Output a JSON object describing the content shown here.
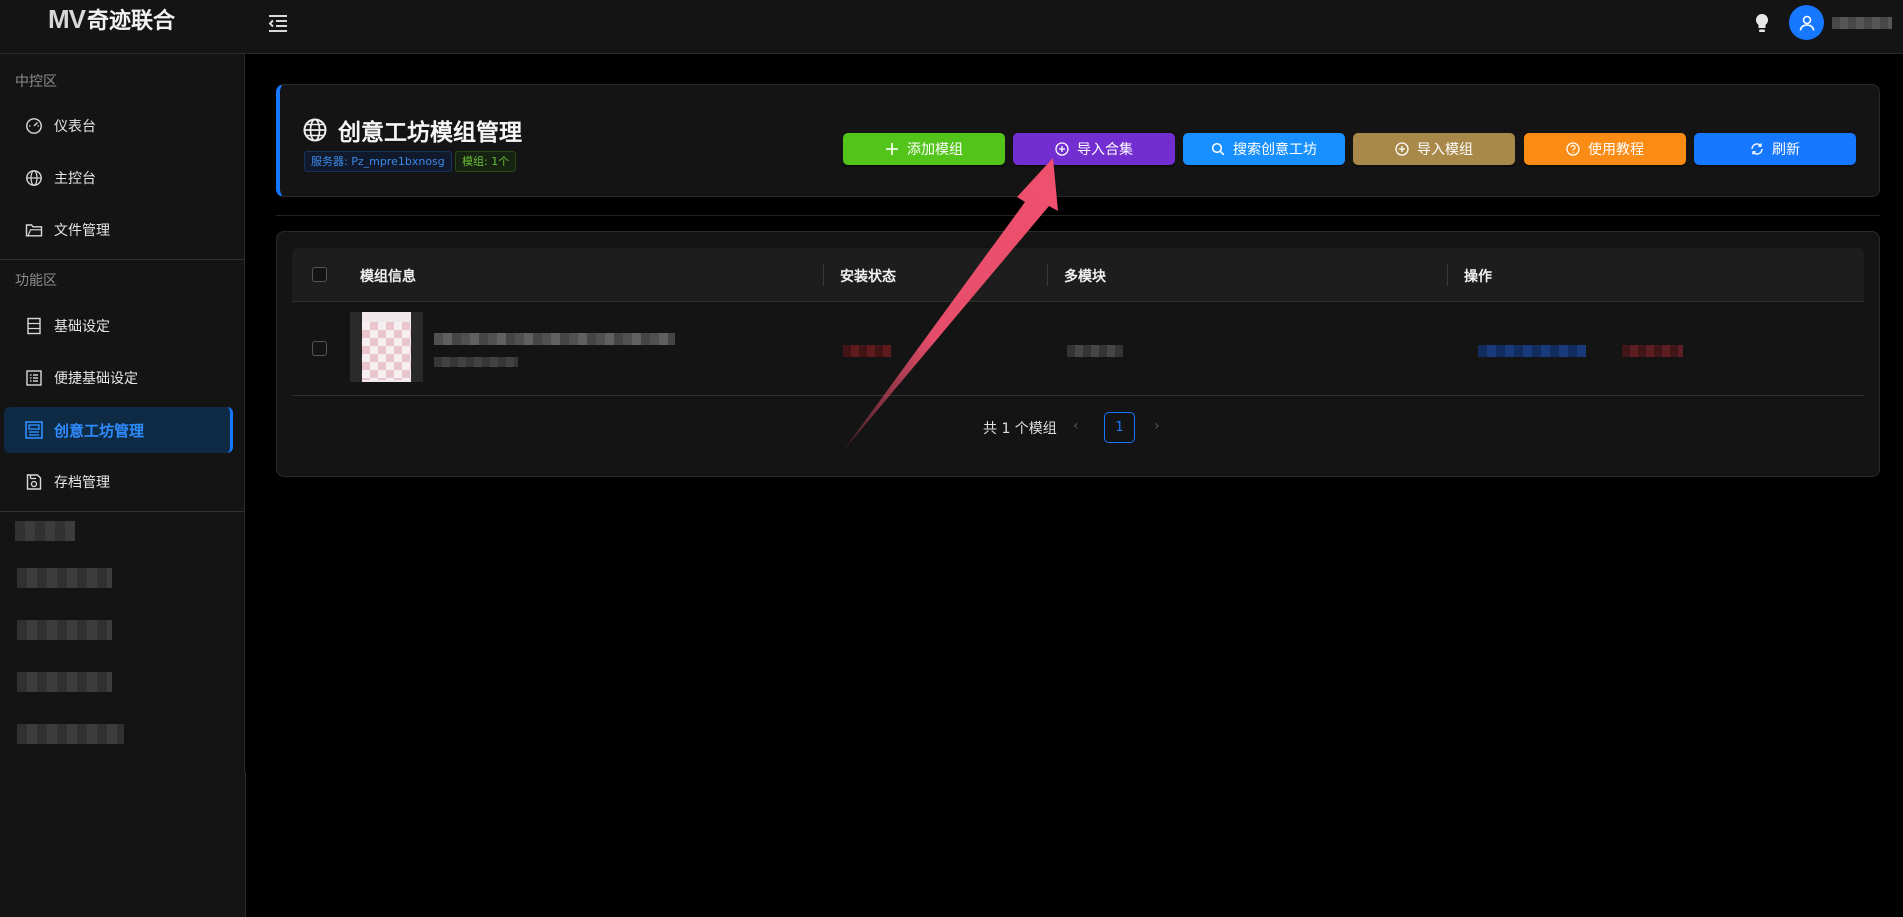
{
  "topbar": {
    "logo_mark": "MV",
    "logo_text": "奇迹联合",
    "menu_icon": "menu-fold-icon",
    "bulb_icon": "bulb-icon",
    "avatar_icon": "user-icon"
  },
  "sidebar": {
    "section_control": "中控区",
    "items_control": [
      {
        "label": "仪表台",
        "icon": "dashboard-icon"
      },
      {
        "label": "主控台",
        "icon": "globe-icon"
      },
      {
        "label": "文件管理",
        "icon": "folder-icon"
      }
    ],
    "section_function": "功能区",
    "items_function": [
      {
        "label": "基础设定",
        "icon": "server-icon"
      },
      {
        "label": "便捷基础设定",
        "icon": "list-icon"
      },
      {
        "label": "创意工坊管理",
        "icon": "workshop-icon",
        "active": true
      },
      {
        "label": "存档管理",
        "icon": "save-icon"
      }
    ]
  },
  "header": {
    "title": "创意工坊模组管理",
    "tag_server": "服务器: Pz_mpre1bxnosg",
    "tag_mods": "模组: 1个",
    "buttons": [
      {
        "label": "添加模组",
        "color": "#52c41a",
        "icon": "plus-icon"
      },
      {
        "label": "导入合集",
        "color": "#722ed1",
        "icon": "plus-circle-icon"
      },
      {
        "label": "搜索创意工坊",
        "color": "#1890ff",
        "icon": "search-icon"
      },
      {
        "label": "导入模组",
        "color": "#a9894a",
        "icon": "plus-circle-icon"
      },
      {
        "label": "使用教程",
        "color": "#fa8c16",
        "icon": "question-circle-icon"
      },
      {
        "label": "刷新",
        "color": "#1677ff",
        "icon": "reload-icon"
      }
    ]
  },
  "table": {
    "columns": [
      "模组信息",
      "安装状态",
      "多模块",
      "操作"
    ]
  },
  "pagination": {
    "total_text": "共 1 个模组",
    "current_page": "1"
  },
  "annotation": {
    "arrow_color": "#f0506e"
  }
}
